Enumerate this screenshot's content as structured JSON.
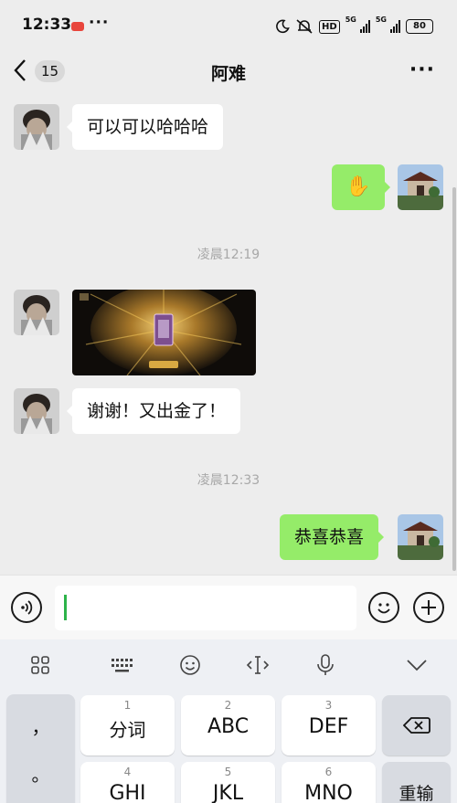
{
  "status_bar": {
    "time": "12:33",
    "more": "···",
    "hd": "HD",
    "net1": "5G",
    "net2": "5G",
    "battery": "80"
  },
  "header": {
    "back_count": "15",
    "title": "阿难",
    "more": "···"
  },
  "messages": [
    {
      "side": "left",
      "type": "text",
      "text": "可以可以哈哈哈"
    },
    {
      "side": "right",
      "type": "emoji",
      "text": "✋"
    },
    {
      "type": "time",
      "text": "凌晨12:19"
    },
    {
      "side": "left",
      "type": "image"
    },
    {
      "side": "left",
      "type": "text",
      "text": "谢谢！又出金了！"
    },
    {
      "type": "time",
      "text": "凌晨12:33"
    },
    {
      "side": "right",
      "type": "text",
      "text": "恭喜恭喜"
    }
  ],
  "input": {
    "value": "",
    "voice_icon": "voice-icon",
    "emoji_icon": "emoji-icon",
    "plus_icon": "plus-icon"
  },
  "keyboard": {
    "toolbar": [
      "apps-icon",
      "keyboard-icon",
      "emoji-icon",
      "cursor-icon",
      "mic-icon",
      "chevron-down-icon"
    ],
    "punct_comma": "，",
    "punct_period": "。",
    "keys": [
      {
        "num": "1",
        "label": "分词"
      },
      {
        "num": "2",
        "label": "ABC"
      },
      {
        "num": "3",
        "label": "DEF"
      },
      {
        "num": "4",
        "label": "GHI"
      },
      {
        "num": "5",
        "label": "JKL"
      },
      {
        "num": "6",
        "label": "MNO"
      }
    ],
    "retype": "重输",
    "backspace_icon": "backspace-icon"
  },
  "colors": {
    "outgoing_bubble": "#95ec69",
    "incoming_bubble": "#ffffff",
    "chat_background": "#ededed",
    "caret": "#2db34a"
  }
}
